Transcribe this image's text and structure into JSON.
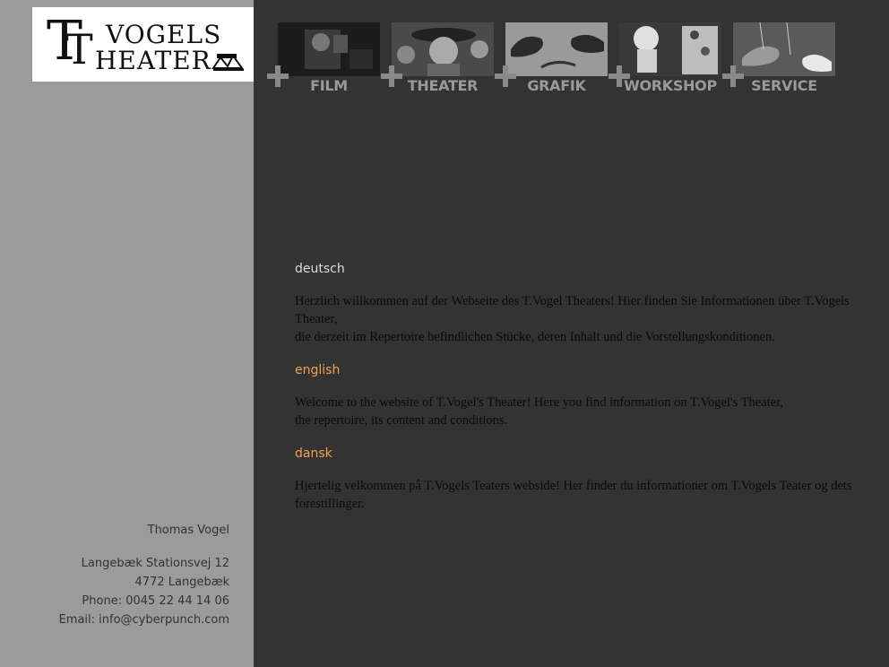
{
  "logo": {
    "letter_t": "T",
    "word_vogels": "VOGELS",
    "letter_t2": "T",
    "word_heater": "HEATER"
  },
  "nav": {
    "items": [
      {
        "label": "FILM"
      },
      {
        "label": "THEATER"
      },
      {
        "label": "GRAFIK"
      },
      {
        "label": "WORKSHOP"
      },
      {
        "label": "SERVICE"
      }
    ]
  },
  "content": {
    "deutsch": {
      "heading": "deutsch",
      "line1": "Herzlich willkommen auf der Webseite des T.Vogel Theaters! Hier finden Sie Informationen über T.Vogels Theater,",
      "line2": "die derzeit im Repertoire befindlichen Stücke, deren Inhalt und die Vorstellungskonditionen."
    },
    "english": {
      "heading": "english",
      "line1": "Welcome to the website of T.Vogel's Theater! Here you find information on T.Vogel's Theater,",
      "line2": "the repertoire, its content and conditions."
    },
    "dansk": {
      "heading": "dansk",
      "line1": "Hjertelig velkommen på T.Vogels Teaters webside! Her finder du informationer om T.Vogels Teater og dets forestillinger."
    }
  },
  "address": {
    "name": "Thomas Vogel",
    "street": "Langebæk Stationsvej 12",
    "city": "4772 Langebæk",
    "phone": "Phone: 0045 22 44 14 06",
    "email": "Email: info@cyberpunch.com"
  },
  "colors": {
    "sidebar_bg": "#9b9b9b",
    "main_bg": "#333333",
    "accent_orange": "#f0a050",
    "nav_label": "#9a9a9a"
  }
}
